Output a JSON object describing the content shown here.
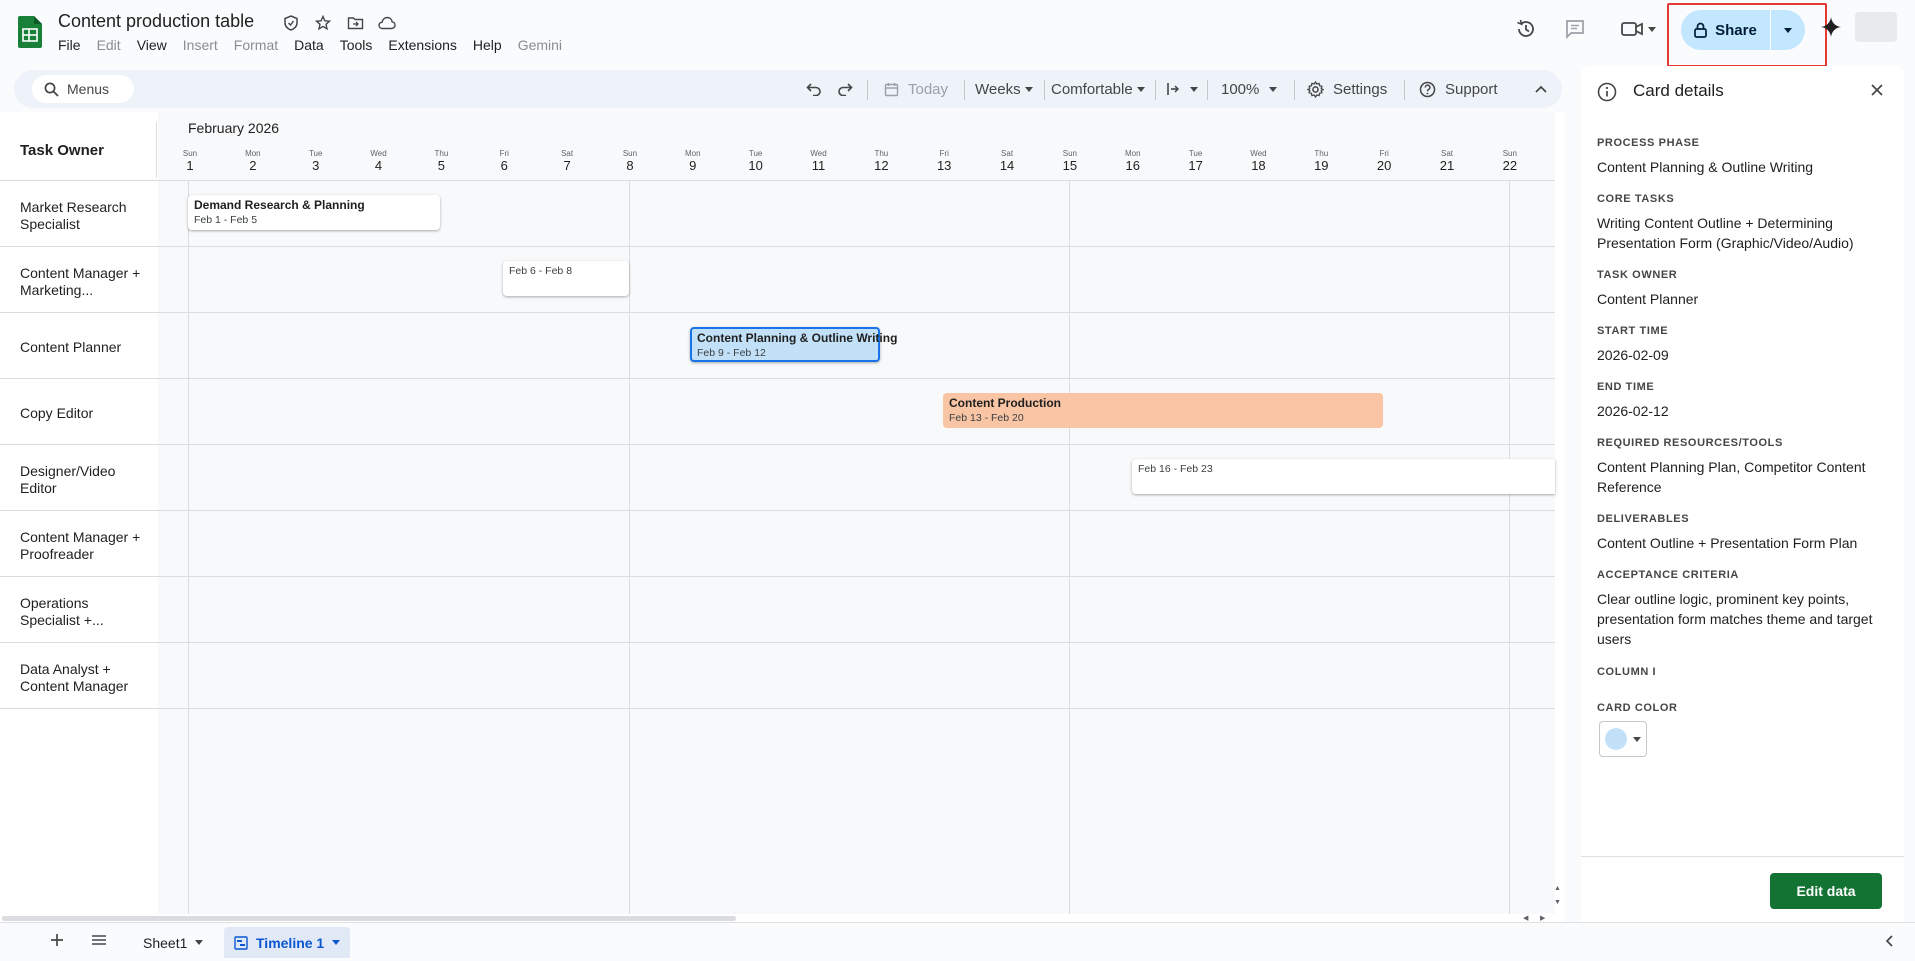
{
  "app": {
    "title": "Content production table",
    "menu": [
      {
        "label": "File",
        "disabled": false
      },
      {
        "label": "Edit",
        "disabled": true
      },
      {
        "label": "View",
        "disabled": false
      },
      {
        "label": "Insert",
        "disabled": true
      },
      {
        "label": "Format",
        "disabled": true
      },
      {
        "label": "Data",
        "disabled": false
      },
      {
        "label": "Tools",
        "disabled": false
      },
      {
        "label": "Extensions",
        "disabled": false
      },
      {
        "label": "Help",
        "disabled": false
      },
      {
        "label": "Gemini",
        "disabled": true
      }
    ],
    "share_label": "Share",
    "brand_color": "#188038",
    "share_color": "#c2e7ff"
  },
  "toolbar": {
    "search_label": "Menus",
    "today": "Today",
    "scale": "Weeks",
    "density": "Comfortable",
    "zoom": "100%",
    "settings": "Settings",
    "support": "Support"
  },
  "timeline": {
    "owner_header": "Task Owner",
    "month": "February 2026",
    "days": [
      {
        "dow": "Sun",
        "num": "1"
      },
      {
        "dow": "Mon",
        "num": "2"
      },
      {
        "dow": "Tue",
        "num": "3"
      },
      {
        "dow": "Wed",
        "num": "4"
      },
      {
        "dow": "Thu",
        "num": "5"
      },
      {
        "dow": "Fri",
        "num": "6"
      },
      {
        "dow": "Sat",
        "num": "7"
      },
      {
        "dow": "Sun",
        "num": "8"
      },
      {
        "dow": "Mon",
        "num": "9"
      },
      {
        "dow": "Tue",
        "num": "10"
      },
      {
        "dow": "Wed",
        "num": "11"
      },
      {
        "dow": "Thu",
        "num": "12"
      },
      {
        "dow": "Fri",
        "num": "13"
      },
      {
        "dow": "Sat",
        "num": "14"
      },
      {
        "dow": "Sun",
        "num": "15"
      },
      {
        "dow": "Mon",
        "num": "16"
      },
      {
        "dow": "Tue",
        "num": "17"
      },
      {
        "dow": "Wed",
        "num": "18"
      },
      {
        "dow": "Thu",
        "num": "19"
      },
      {
        "dow": "Fri",
        "num": "20"
      },
      {
        "dow": "Sat",
        "num": "21"
      },
      {
        "dow": "Sun",
        "num": "22"
      }
    ],
    "owners": [
      "Market Research Specialist",
      "Content Manager + Marketing...",
      "Content Planner",
      "Copy Editor",
      "Designer/Video Editor",
      "Content Manager + Proofreader",
      "Operations Specialist +...",
      "Data Analyst + Content Manager"
    ],
    "cards": [
      {
        "title": "Demand Research & Planning",
        "dates": "Feb 1 - Feb 5"
      },
      {
        "title": "",
        "dates": "Feb 6 - Feb 8"
      },
      {
        "title": "Content Planning & Outline Writing",
        "dates": "Feb 9 - Feb 12"
      },
      {
        "title": "Content Production",
        "dates": "Feb 13 - Feb 20"
      },
      {
        "title": "",
        "dates": "Feb 16 - Feb 23"
      }
    ]
  },
  "panel": {
    "title": "Card details",
    "fields": [
      {
        "label": "PROCESS PHASE",
        "value": "Content Planning & Outline Writing"
      },
      {
        "label": "CORE TASKS",
        "value": "Writing Content Outline + Determining Presentation Form (Graphic/Video/Audio)"
      },
      {
        "label": "TASK OWNER",
        "value": "Content Planner"
      },
      {
        "label": "START TIME",
        "value": "2026-02-09"
      },
      {
        "label": "END TIME",
        "value": "2026-02-12"
      },
      {
        "label": "REQUIRED RESOURCES/TOOLS",
        "value": "Content Planning Plan, Competitor Content Reference"
      },
      {
        "label": "DELIVERABLES",
        "value": "Content Outline + Presentation Form Plan"
      },
      {
        "label": "ACCEPTANCE CRITERIA",
        "value": "Clear outline logic, prominent key points, presentation form matches theme and target users"
      },
      {
        "label": "COLUMN I",
        "value": ""
      },
      {
        "label": "CARD COLOR",
        "value": ""
      }
    ],
    "card_color": "#c2e1f8",
    "edit_label": "Edit data"
  },
  "sheets": {
    "tabs": [
      "Sheet1",
      "Timeline 1"
    ],
    "active": "Timeline 1"
  }
}
